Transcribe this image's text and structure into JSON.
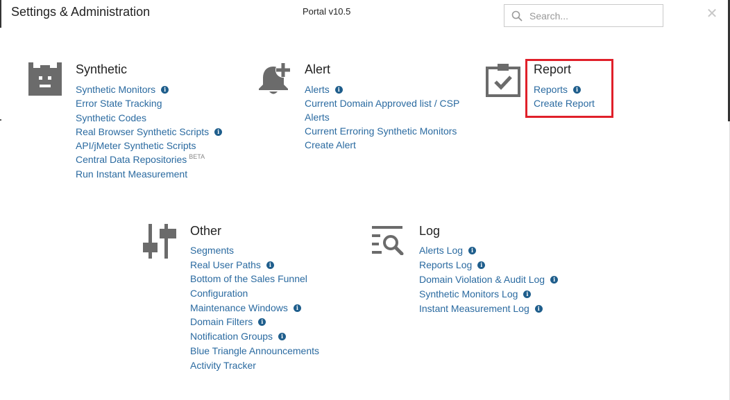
{
  "header": {
    "title": "Settings & Administration",
    "version": "Portal v10.5",
    "search_placeholder": "Search...",
    "close_symbol": "✕"
  },
  "icons": {
    "synthetic": "robot-icon",
    "alert": "bell-plus-icon",
    "report": "clipboard-check-icon",
    "other": "sliders-icon",
    "log": "list-search-icon",
    "info": "info-icon",
    "search": "search-icon"
  },
  "colors": {
    "link": "#2a6aa0",
    "info": "#1f5e8c",
    "icon": "#6b6b6b",
    "highlight": "#e0202a"
  },
  "synthetic": {
    "title": "Synthetic",
    "links": [
      {
        "label": "Synthetic Monitors",
        "info": true
      },
      {
        "label": "Error State Tracking",
        "info": false
      },
      {
        "label": "Synthetic Codes",
        "info": false
      },
      {
        "label": "Real Browser Synthetic Scripts",
        "info": true
      },
      {
        "label": "API/jMeter Synthetic Scripts",
        "info": false
      },
      {
        "label": "Central Data Repositories",
        "info": false,
        "badge": "BETA"
      },
      {
        "label": "Run Instant Measurement",
        "info": false
      }
    ]
  },
  "alert": {
    "title": "Alert",
    "links": [
      {
        "label": "Alerts",
        "info": true
      },
      {
        "label": "Current Domain Approved list / CSP",
        "info": false
      },
      {
        "label": "Alerts",
        "info": false
      },
      {
        "label": "Current Erroring Synthetic Monitors",
        "info": false
      },
      {
        "label": "Create Alert",
        "info": false
      }
    ]
  },
  "report": {
    "title": "Report",
    "links": [
      {
        "label": "Reports",
        "info": true
      },
      {
        "label": "Create Report",
        "info": false
      }
    ]
  },
  "other": {
    "title": "Other",
    "links": [
      {
        "label": "Segments",
        "info": false
      },
      {
        "label": "Real User Paths",
        "info": true
      },
      {
        "label": "Bottom of the Sales Funnel",
        "info": false
      },
      {
        "label": "Configuration",
        "info": false
      },
      {
        "label": "Maintenance Windows",
        "info": true
      },
      {
        "label": "Domain Filters",
        "info": true
      },
      {
        "label": "Notification Groups",
        "info": true
      },
      {
        "label": "Blue Triangle Announcements",
        "info": false
      },
      {
        "label": "Activity Tracker",
        "info": false
      }
    ]
  },
  "log": {
    "title": "Log",
    "links": [
      {
        "label": "Alerts Log",
        "info": true
      },
      {
        "label": "Reports Log",
        "info": true
      },
      {
        "label": "Domain Violation & Audit Log",
        "info": true
      },
      {
        "label": "Synthetic Monitors Log",
        "info": true
      },
      {
        "label": "Instant Measurement Log",
        "info": true
      }
    ]
  }
}
